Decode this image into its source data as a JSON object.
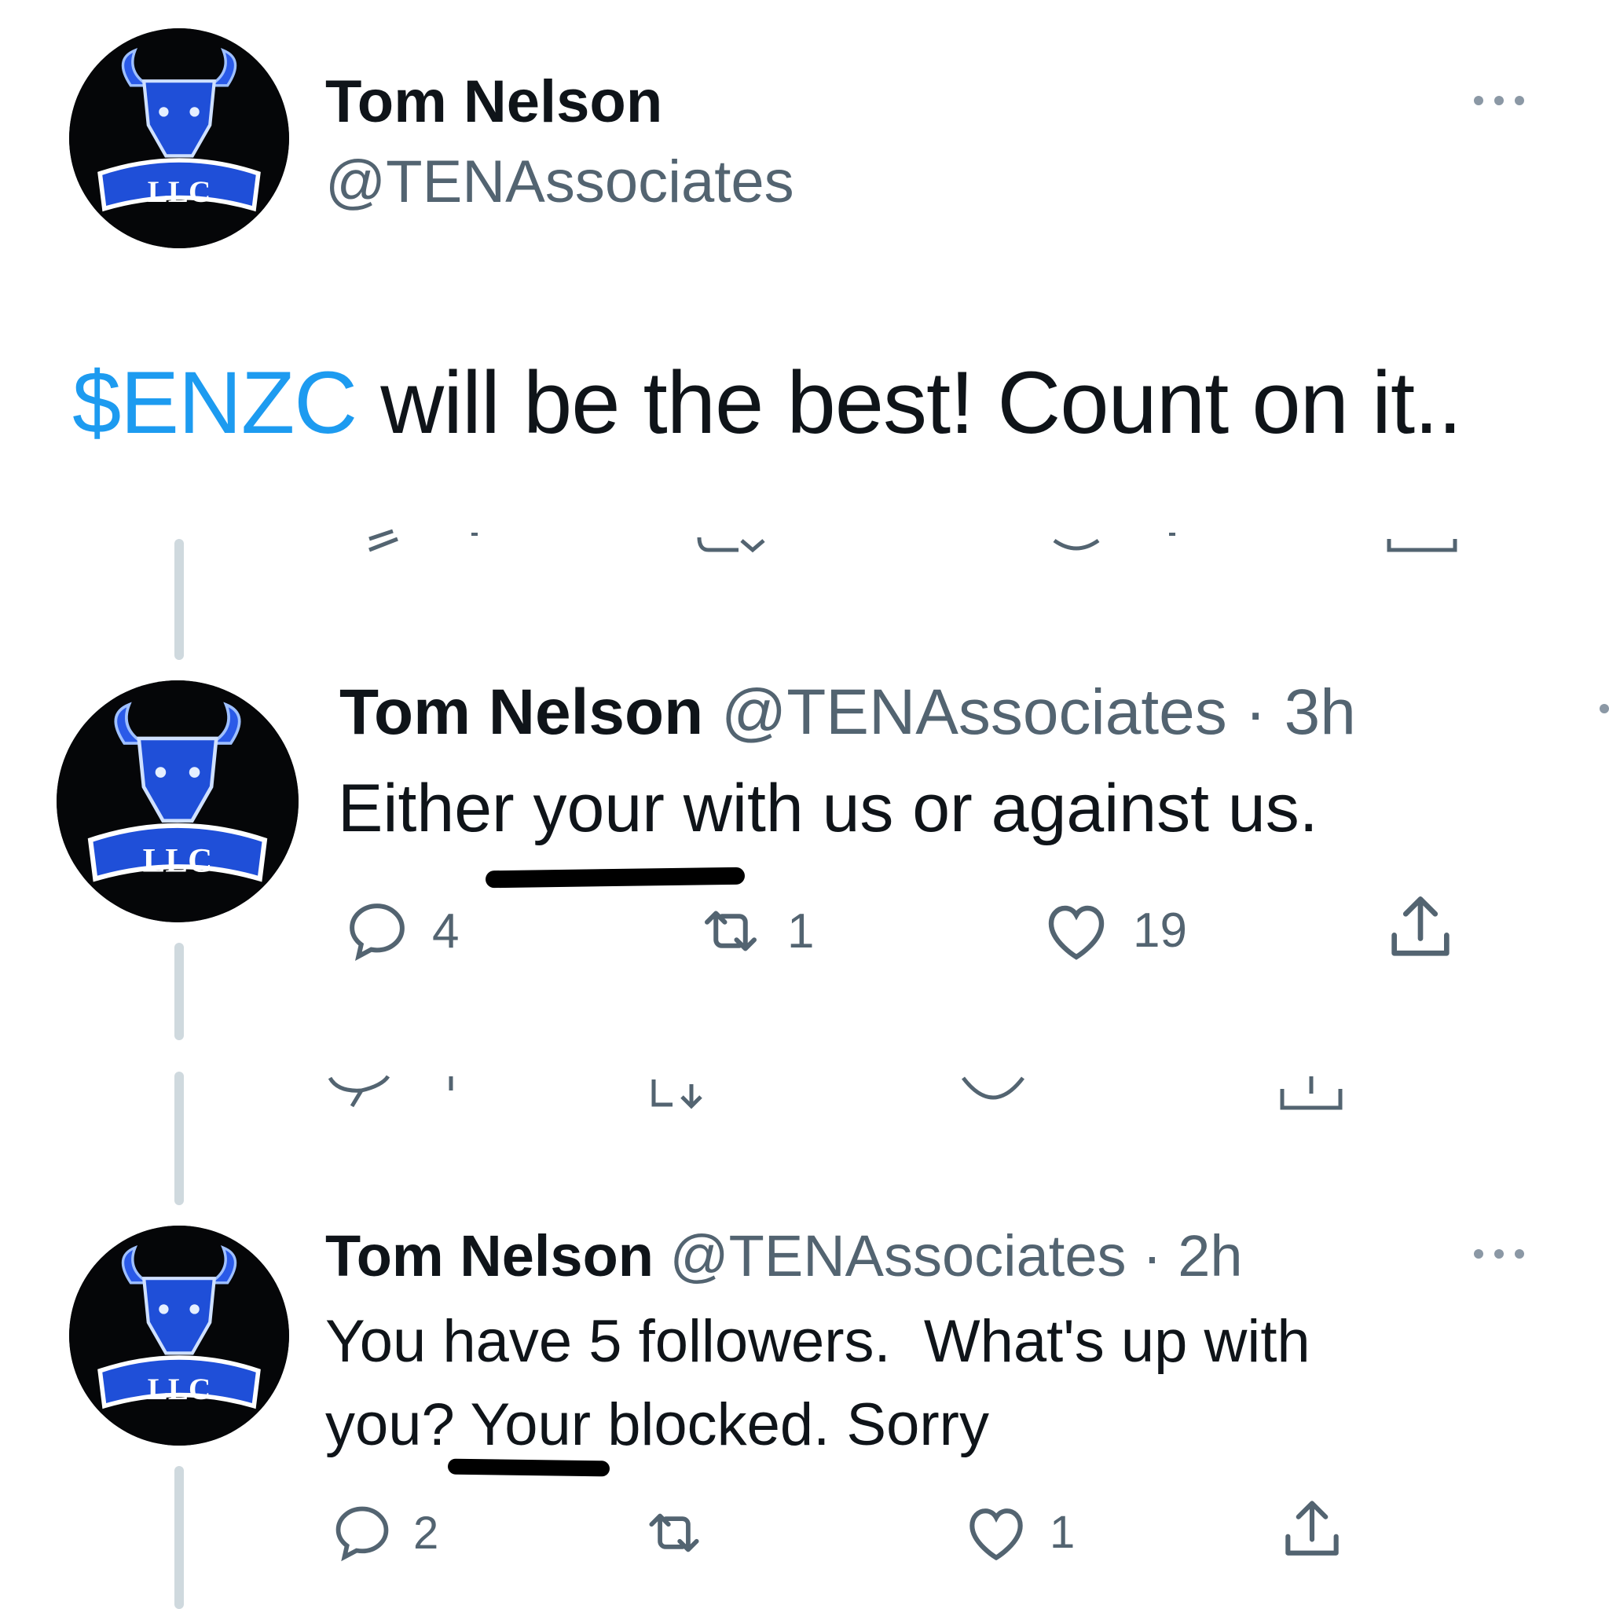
{
  "main_tweet": {
    "name": "Tom Nelson",
    "handle": "@TENAssociates",
    "cashtag": "$ENZC",
    "text": " will be the best! Count on it.."
  },
  "reply1": {
    "name": "Tom Nelson",
    "handle": "@TENAssociates",
    "time": "· 3h",
    "text": "Either your with us or against us.",
    "reply_count": "4",
    "retweet_count": "1",
    "like_count": "19"
  },
  "reply2": {
    "name": "Tom Nelson",
    "handle": "@TENAssociates",
    "time": "· 2h",
    "text_line1": "You have 5 followers.  What's up with",
    "text_line2_a": "you? ",
    "text_line2_b": "Your",
    "text_line2_c": " blocked. Sorry",
    "reply_count": "2",
    "retweet_count": "",
    "like_count": "1"
  },
  "avatar": {
    "logo_text": "LLC",
    "bg_color": "#050608",
    "accent_color": "#1f4fd8"
  },
  "colors": {
    "link": "#1d9bf0",
    "secondary": "#536471",
    "marker": "#000000"
  }
}
